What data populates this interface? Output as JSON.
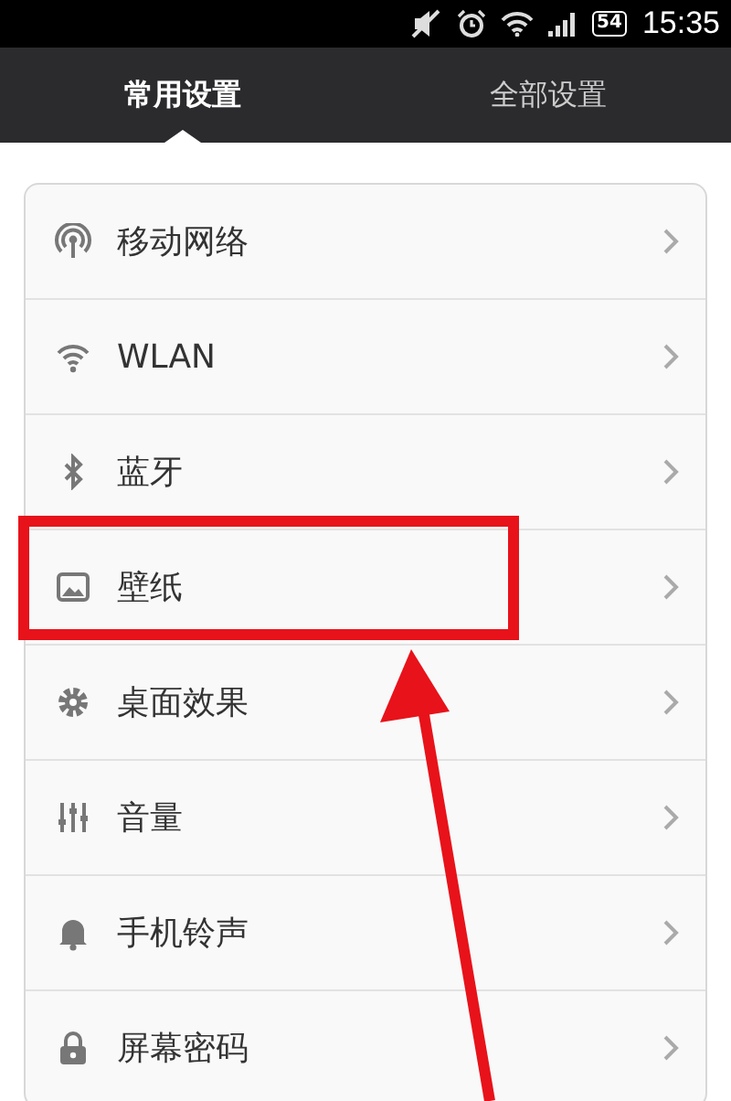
{
  "status_bar": {
    "battery": "54",
    "time": "15:35"
  },
  "tabs": [
    {
      "label": "常用设置",
      "selected": true
    },
    {
      "label": "全部设置",
      "selected": false
    }
  ],
  "settings": [
    {
      "label": "移动网络",
      "highlighted": false
    },
    {
      "label": "WLAN",
      "highlighted": false
    },
    {
      "label": "蓝牙",
      "highlighted": false
    },
    {
      "label": "壁纸",
      "highlighted": true
    },
    {
      "label": "桌面效果",
      "highlighted": false
    },
    {
      "label": "音量",
      "highlighted": false
    },
    {
      "label": "手机铃声",
      "highlighted": false
    },
    {
      "label": "屏幕密码",
      "highlighted": false
    }
  ]
}
